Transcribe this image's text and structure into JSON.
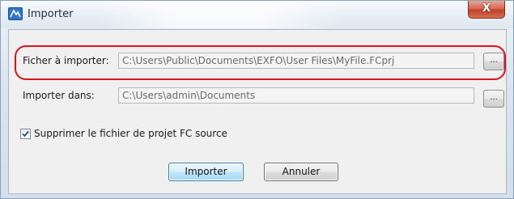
{
  "window": {
    "title": "Importer",
    "close_label": "X"
  },
  "form": {
    "source_file_label": "Ficher à importer:",
    "source_file_value": "C:\\Users\\Public\\Documents\\EXFO\\User Files\\MyFile.FCprj",
    "destination_label": "Importer dans:",
    "destination_value": "C:\\Users\\admin\\Documents",
    "browse_label": "...",
    "delete_source_checked": true,
    "delete_source_label": "Supprimer le fichier de projet FC source"
  },
  "buttons": {
    "import_label": "Importer",
    "cancel_label": "Annuler"
  },
  "colors": {
    "highlight": "#e0121a",
    "default_button_border": "#3c7fb1"
  }
}
